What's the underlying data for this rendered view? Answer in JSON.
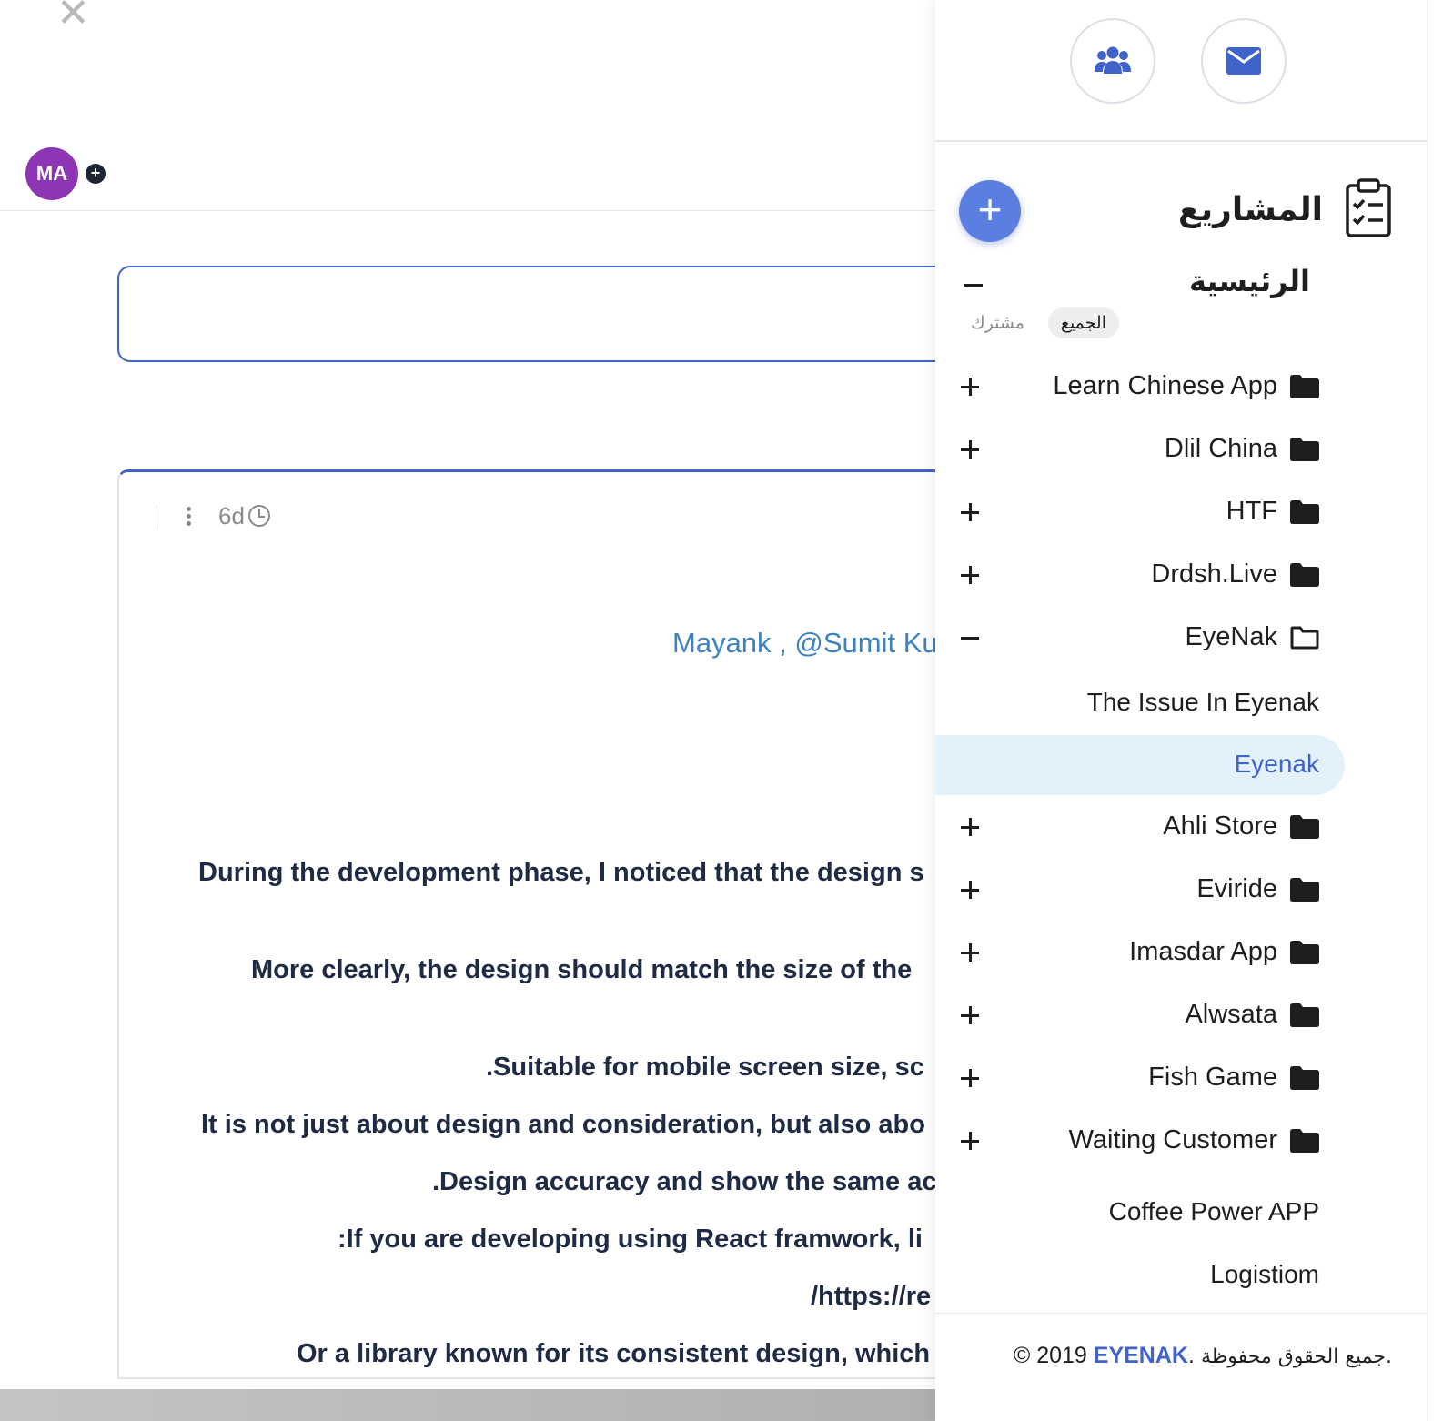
{
  "main": {
    "avatar_initials": "MA",
    "post": {
      "time": "6d",
      "mention": "Mayank , @Sumit Kur",
      "lines": [
        "During the development phase, I noticed that the design s",
        "More clearly, the design should match the size of the",
        ".Suitable for mobile screen size, sc",
        "It is not just about design and consideration, but also abo",
        ".Design accuracy and show the same ac",
        ":If you are developing using React framwork, li",
        "/https://re",
        "Or a library known for its consistent design, which"
      ]
    }
  },
  "sidebar": {
    "section_title": "المشاريع",
    "home_title": "الرئيسية",
    "filters": {
      "all": "الجميع",
      "shared": "مشترك"
    },
    "projects": [
      {
        "name": "Learn Chinese App",
        "toggle": "plus",
        "folder": "closed"
      },
      {
        "name": "Dlil China",
        "toggle": "plus",
        "folder": "closed"
      },
      {
        "name": "HTF",
        "toggle": "plus",
        "folder": "closed"
      },
      {
        "name": "Drdsh.Live",
        "toggle": "plus",
        "folder": "closed"
      },
      {
        "name": "EyeNak",
        "toggle": "minus",
        "folder": "open"
      },
      {
        "name": "Ahli Store",
        "toggle": "plus",
        "folder": "closed"
      },
      {
        "name": "Eviride",
        "toggle": "plus",
        "folder": "closed"
      },
      {
        "name": "Imasdar App",
        "toggle": "plus",
        "folder": "closed"
      },
      {
        "name": "Alwsata",
        "toggle": "plus",
        "folder": "closed"
      },
      {
        "name": "Fish Game",
        "toggle": "plus",
        "folder": "closed"
      },
      {
        "name": "Waiting Customer",
        "toggle": "plus",
        "folder": "closed"
      }
    ],
    "subitems": [
      {
        "name": "The Issue In Eyenak",
        "active": false
      },
      {
        "name": "Eyenak",
        "active": true
      }
    ],
    "extra_items": [
      "Coffee Power APP",
      "Logistiom"
    ],
    "footer": {
      "copyright": "© 2019",
      "brand": "EYENAK",
      "rights": ". جميع الحقوق محفوظة."
    }
  },
  "colors": {
    "accent": "#3f63c8",
    "fab": "#5b7fe0",
    "avatar": "#8e35b4",
    "mention": "#3b83c5",
    "active_bg": "#e3f1fb"
  },
  "icons": [
    "close-icon",
    "plus-circle-icon",
    "users-icon",
    "mail-icon",
    "clipboard-check-icon",
    "folder-icon",
    "folder-open-icon",
    "clock-icon",
    "kebab-menu-icon"
  ]
}
